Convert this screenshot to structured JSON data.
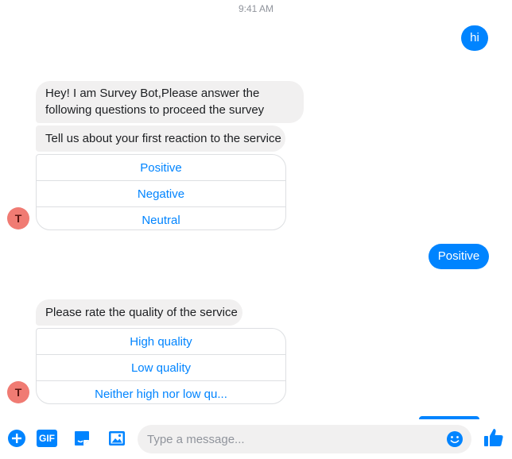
{
  "timestamp": "9:41 AM",
  "messages": {
    "user_hi": "hi",
    "bot_intro_line1": "Hey! I am Survey Bot,Please answer the",
    "bot_intro_line2": "following questions to proceed the survey",
    "bot_question1": "Tell us about your first reaction to the service",
    "user_positive": "Positive",
    "bot_question2": "Please rate the quality of the service"
  },
  "quick_replies_1": [
    "Positive",
    "Negative",
    "Neutral"
  ],
  "quick_replies_2": [
    "High quality",
    "Low quality",
    "Neither high nor low qu..."
  ],
  "avatar_initial": "T",
  "composer": {
    "placeholder": "Type a message...",
    "gif_label": "GIF",
    "icons": [
      "plus-icon",
      "gif-icon",
      "sticker-icon",
      "image-icon",
      "emoji-icon",
      "thumbs-up-icon"
    ]
  },
  "colors": {
    "accent": "#0084ff",
    "bubble_in": "#f1f0f0",
    "avatar": "#f07b73"
  }
}
